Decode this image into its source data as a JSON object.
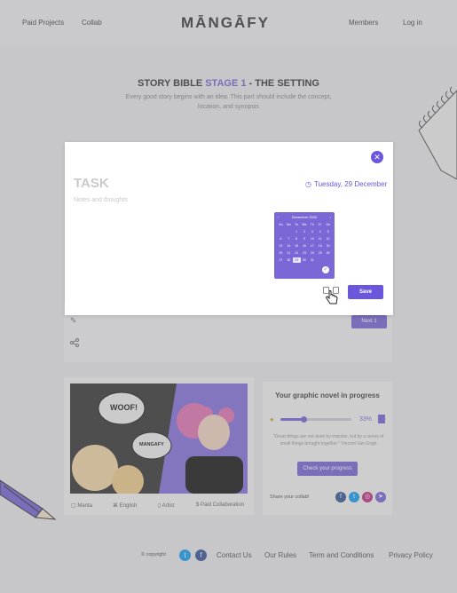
{
  "header": {
    "nav_left": [
      "Paid Projects",
      "Collab"
    ],
    "logo": "MĀNGĀFY",
    "nav_right": [
      "Members",
      "Log in"
    ]
  },
  "hero": {
    "title_prefix": "STORY BIBLE ",
    "title_accent": "STAGE 1",
    "title_suffix": " - THE SETTING",
    "subtitle": "Every good story begins with an idea. This part should include the concept, location, and synopsis"
  },
  "modal": {
    "task_title": "TASK",
    "notes_placeholder": "Notes and thoughts",
    "date_label": "Tuesday, 29 December",
    "save_label": "Save",
    "close_icon": "close-icon"
  },
  "calendar": {
    "month_label": "December 2020",
    "weekdays": [
      "Su",
      "Mo",
      "Tu",
      "We",
      "Th",
      "Fr",
      "Sa"
    ],
    "days": [
      "",
      "",
      "1",
      "2",
      "3",
      "4",
      "5",
      "6",
      "7",
      "8",
      "9",
      "10",
      "11",
      "12",
      "13",
      "14",
      "15",
      "16",
      "17",
      "18",
      "19",
      "20",
      "21",
      "22",
      "23",
      "24",
      "25",
      "26",
      "27",
      "28",
      "29",
      "30",
      "31",
      "",
      ""
    ],
    "selected_day": "29"
  },
  "background": {
    "report_label": "Next 1",
    "progress_title": "Your graphic novel in progress",
    "progress_percent": "33%",
    "progress_value": 0.33,
    "quote": "\"Great things are not done by impulse, but by a series of small things brought together.\" Vincent Van Gogh",
    "check_label": "Check your progress",
    "share_label": "Share your collab!",
    "comic_meta": [
      "Manta",
      "English",
      "Artist",
      "Paid Collaboration"
    ],
    "speech_1": "WOOF!",
    "speech_2": "MANGAFY"
  },
  "footer": {
    "copyright": "© copyright",
    "links": [
      "Contact Us",
      "Our Rules",
      "Term and Conditions",
      "Privacy Policy"
    ]
  },
  "colors": {
    "accent": "#6b57dc",
    "accent_soft": "#7b68d6"
  }
}
